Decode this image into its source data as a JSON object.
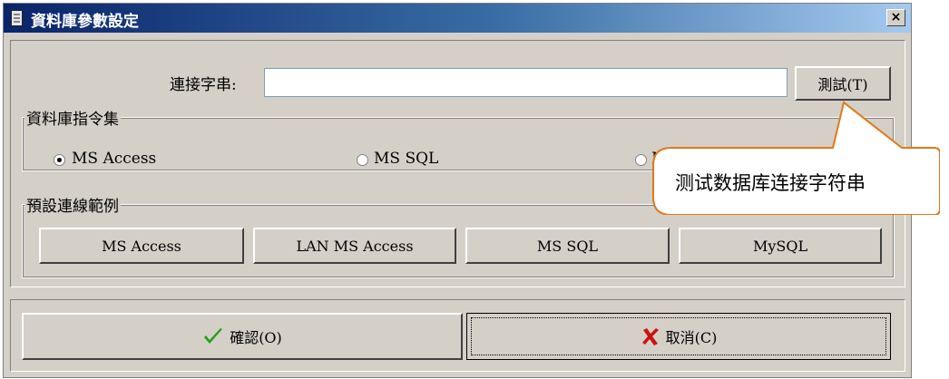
{
  "window": {
    "title": "資料庫參數設定",
    "close_label": "×"
  },
  "connection": {
    "label": "連接字串:",
    "value": "",
    "test_button": "測試(T)"
  },
  "command_set": {
    "title": "資料庫指令集",
    "options": [
      {
        "label": "MS Access",
        "selected": true
      },
      {
        "label": "MS SQL",
        "selected": false
      },
      {
        "label": "M",
        "selected": false
      }
    ]
  },
  "examples": {
    "title": "預設連線範例",
    "buttons": [
      "MS Access",
      "LAN MS Access",
      "MS SQL",
      "MySQL"
    ]
  },
  "footer": {
    "ok_label": "確認(O)",
    "cancel_label": "取消(C)"
  },
  "callout": {
    "text": "测试数据库连接字符串"
  },
  "colors": {
    "title_start": "#0a246a",
    "title_end": "#a6caf0",
    "check": "#2e9a1e",
    "cross": "#cc1111",
    "callout_border": "#e2771c"
  }
}
